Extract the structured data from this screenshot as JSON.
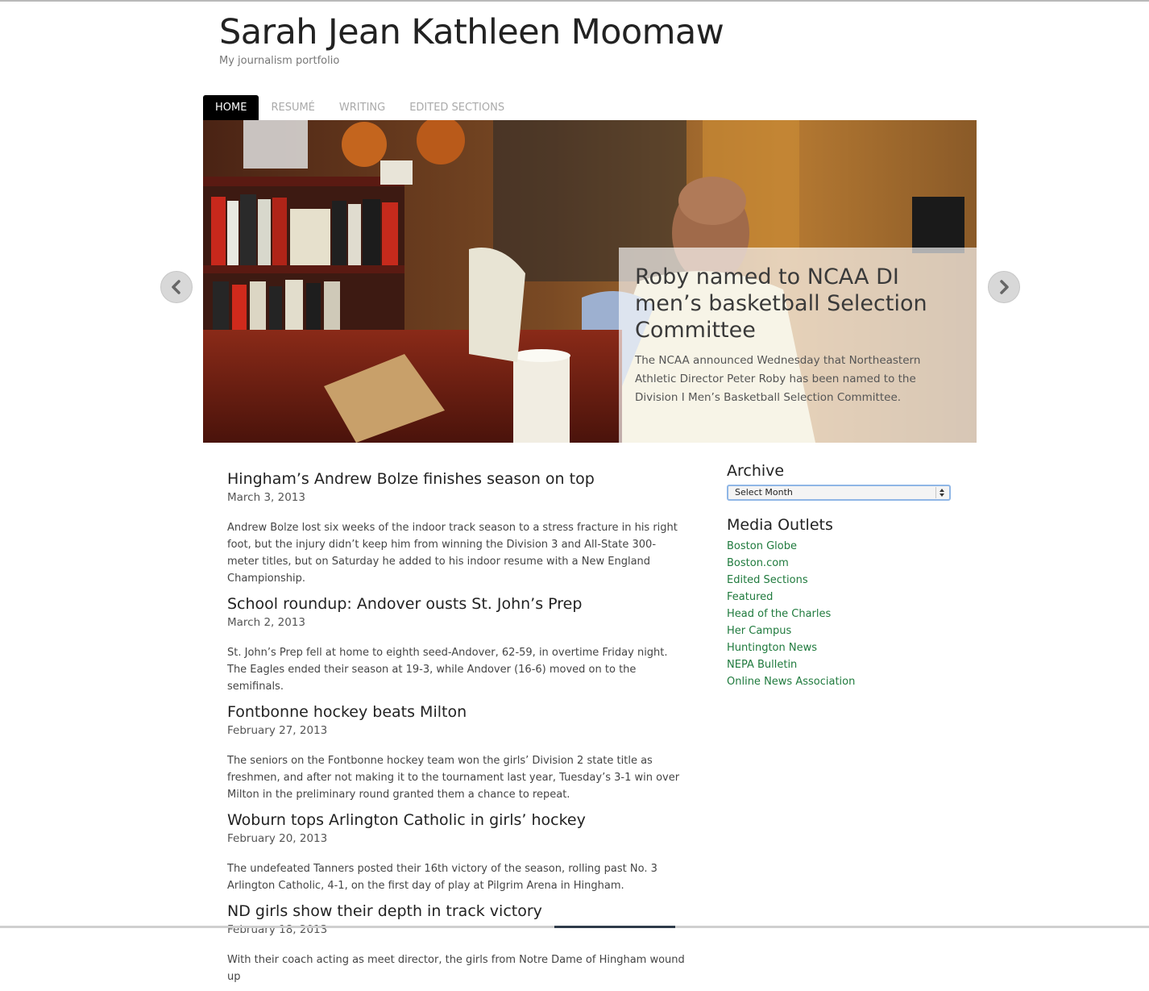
{
  "site": {
    "title": "Sarah Jean Kathleen Moomaw",
    "description": "My journalism portfolio"
  },
  "nav": {
    "items": [
      {
        "label": "HOME",
        "active": true
      },
      {
        "label": "RESUMÉ",
        "active": false
      },
      {
        "label": "WRITING",
        "active": false
      },
      {
        "label": "EDITED SECTIONS",
        "active": false
      }
    ]
  },
  "slider": {
    "title": "Roby named to NCAA DI men’s basketball Selection Committee",
    "excerpt": "The NCAA announced Wednesday that Northeastern Athletic Director Peter Roby has been named to the Division I Men’s Basketball Selection Committee.",
    "prev_icon": "chevron-left-icon",
    "next_icon": "chevron-right-icon"
  },
  "posts": [
    {
      "title": "Hingham’s Andrew Bolze finishes season on top",
      "date": "March 3, 2013",
      "excerpt": "Andrew Bolze lost six weeks of the indoor track season to a stress fracture in his right foot, but the injury didn’t keep him from winning the Division 3 and All-State 300-meter titles, but on Saturday he added to his indoor resume with a New England Championship."
    },
    {
      "title": "School roundup: Andover ousts St. John’s Prep",
      "date": "March 2, 2013",
      "excerpt": "St. John’s Prep fell at home to eighth seed-Andover, 62-59, in overtime Friday night. The Eagles ended their season at 19-3, while Andover (16-6) moved on to the semifinals."
    },
    {
      "title": "Fontbonne hockey beats Milton",
      "date": "February 27, 2013",
      "excerpt": "The seniors on the Fontbonne hockey team won the girls’ Division 2 state title as freshmen, and after not making it to the tournament last year, Tuesday’s 3-1 win over Milton in the preliminary round granted them a chance to repeat."
    },
    {
      "title": "Woburn tops Arlington Catholic in girls’ hockey",
      "date": "February 20, 2013",
      "excerpt": "The undefeated Tanners posted their 16th victory of the season, rolling past No. 3 Arlington Catholic, 4-1, on the first day of play at Pilgrim Arena in Hingham."
    },
    {
      "title": "ND girls show their depth in track victory",
      "date": "February 18, 2013",
      "excerpt": "With their coach acting as meet director, the girls from Notre Dame of Hingham wound up"
    }
  ],
  "sidebar": {
    "archive_title": "Archive",
    "archive_select": "Select Month",
    "outlets_title": "Media Outlets",
    "outlets": [
      "Boston Globe",
      "Boston.com",
      "Edited Sections",
      "Featured",
      "Head of the Charles",
      "Her Campus",
      "Huntington News",
      "NEPA Bulletin",
      "Online News Association"
    ],
    "link_color": "#1f7a3d"
  }
}
